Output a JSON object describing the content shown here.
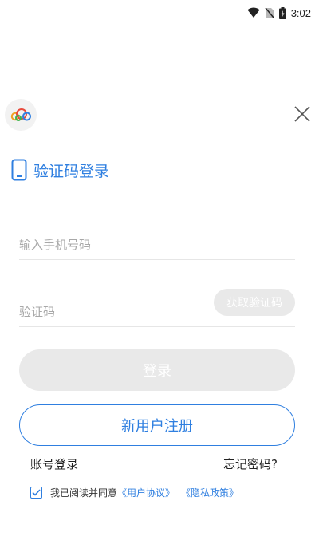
{
  "status_bar": {
    "time": "3:02",
    "icons": [
      "wifi-icon",
      "no-sim-icon",
      "battery-charging-icon"
    ]
  },
  "header": {
    "logo_icon": "cloud-logo-icon",
    "close_icon": "close-icon"
  },
  "login": {
    "title": "验证码登录",
    "title_icon": "phone-icon",
    "phone_placeholder": "输入手机号码",
    "phone_value": "",
    "code_placeholder": "验证码",
    "code_value": "",
    "get_code_label": "获取验证码",
    "login_label": "登录",
    "register_label": "新用户注册",
    "account_login_label": "账号登录",
    "forgot_password_label": "忘记密码?"
  },
  "agreement": {
    "checked": true,
    "text": "我已阅读并同意",
    "user_agreement": "《用户协议》",
    "privacy_policy": "《隐私政策》"
  },
  "colors": {
    "accent": "#2f7fe0",
    "disabled_button": "#e9e9e9",
    "placeholder": "#a8a8a8"
  }
}
